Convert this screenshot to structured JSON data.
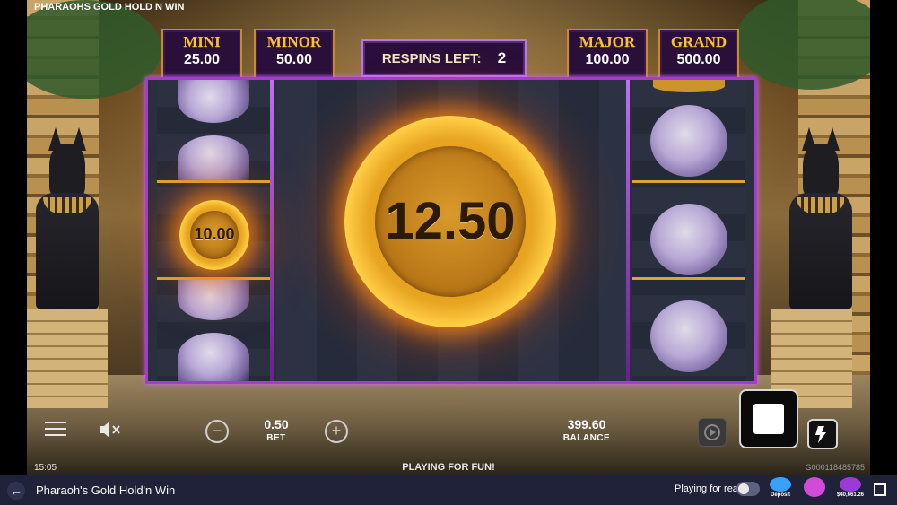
{
  "game_title": "PHARAOHS GOLD HOLD N WIN",
  "jackpots": [
    {
      "name": "MINI",
      "value": "25.00"
    },
    {
      "name": "MINOR",
      "value": "50.00"
    },
    {
      "name": "MAJOR",
      "value": "100.00"
    },
    {
      "name": "GRAND",
      "value": "500.00"
    }
  ],
  "respins": {
    "label": "RESPINS LEFT:",
    "value": "2"
  },
  "coins": {
    "small": "10.00",
    "big": "12.50"
  },
  "controls": {
    "bet_value": "0.50",
    "bet_label": "BET",
    "balance_value": "399.60",
    "balance_label": "BALANCE",
    "minus_label": "−",
    "plus_label": "+"
  },
  "status": {
    "time": "15:05",
    "mode": "PLAYING FOR FUN!",
    "session_id": "G000118485785"
  },
  "footer": {
    "back_label": "←",
    "title": "Pharaoh's Gold Hold'n Win",
    "playing_for_real": "Playing for real",
    "promos": [
      {
        "name": "bonus",
        "label": "Deposit",
        "color": "#3aa0ff"
      },
      {
        "name": "free-spins",
        "label": "",
        "color": "#d24bd8"
      },
      {
        "name": "jackpotz",
        "label": "$40,661.26",
        "color": "#9a3bd8"
      }
    ]
  },
  "colors": {
    "accent_purple": "#a53bd1",
    "gold": "#f5c23a",
    "footer_bg": "#1f2238"
  }
}
